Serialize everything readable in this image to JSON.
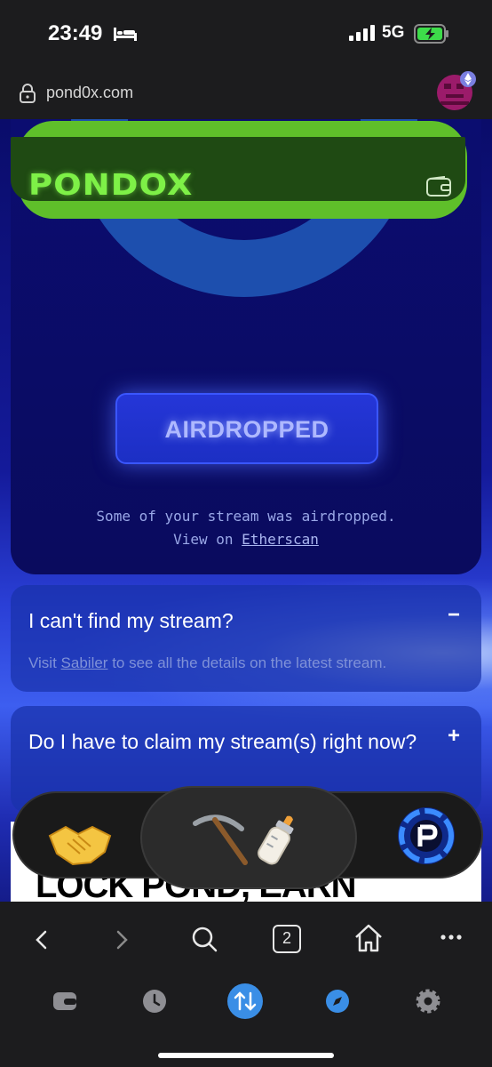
{
  "status": {
    "time": "23:49",
    "network": "5G"
  },
  "browser": {
    "url": "pond0x.com",
    "tab_count": "2"
  },
  "site": {
    "logo": "PONDOX",
    "airdrop_label": "AIRDROPPED",
    "stream_note_line1": "Some of your stream was airdropped.",
    "stream_note_view": "View on ",
    "stream_note_link": "Etherscan",
    "faq": [
      {
        "question": "I can't find my stream?",
        "toggle": "−",
        "answer_prefix": "Visit ",
        "answer_link": "Sabiler",
        "answer_suffix": " to see all the details on the latest stream."
      },
      {
        "question": "Do I have to claim my stream(s) right now?",
        "toggle": "+"
      }
    ],
    "partial_heading": "LOCK POND, EARN"
  },
  "colors": {
    "accent_green": "#7ef047",
    "accent_blue": "#2536d8",
    "bg": "#1c1c1e"
  },
  "icons": [
    "bed-icon",
    "signal-icon",
    "battery-icon",
    "lock-icon",
    "wallet-icon",
    "handshake-icon",
    "pickaxe-icon",
    "baby-bottle-icon",
    "pond-logo-icon",
    "back-icon",
    "forward-icon",
    "search-icon",
    "tabs-icon",
    "home-icon",
    "more-icon",
    "wallet-tab-icon",
    "history-icon",
    "swap-icon",
    "explore-icon",
    "settings-icon"
  ]
}
